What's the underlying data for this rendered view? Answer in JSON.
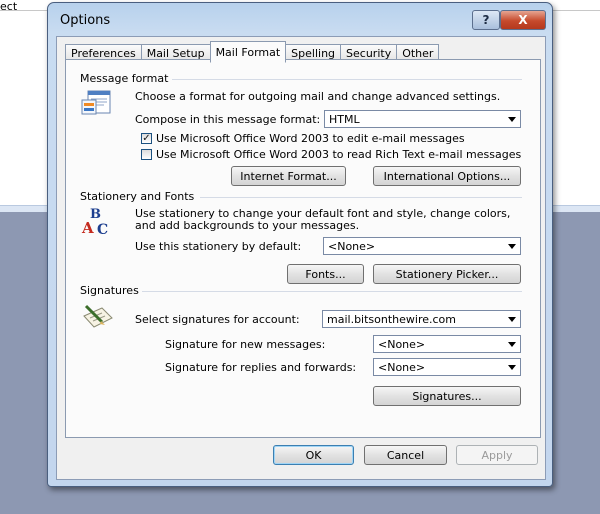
{
  "background": {
    "corner_text": "ect"
  },
  "dialog": {
    "title": "Options",
    "help_glyph": "?",
    "close_glyph": "X",
    "tabs": [
      {
        "label": "Preferences",
        "active": false
      },
      {
        "label": "Mail Setup",
        "active": false
      },
      {
        "label": "Mail Format",
        "active": true
      },
      {
        "label": "Spelling",
        "active": false
      },
      {
        "label": "Security",
        "active": false
      },
      {
        "label": "Other",
        "active": false
      }
    ],
    "message_format": {
      "label": "Message format",
      "description": "Choose a format for outgoing mail and change advanced settings.",
      "compose_label": "Compose in this message format:",
      "compose_value": "HTML",
      "word_edit": {
        "label": "Use Microsoft Office Word 2003 to edit e-mail messages",
        "checked": true,
        "glyph": "✓"
      },
      "word_read": {
        "label": "Use Microsoft Office Word 2003 to read Rich Text e-mail messages",
        "checked": false
      },
      "internet_format_button": "Internet Format...",
      "international_options_button": "International Options..."
    },
    "stationery": {
      "label": "Stationery and Fonts",
      "description_1": "Use stationery to change your default font and style, change colors,",
      "description_2": "and add backgrounds to your messages.",
      "default_label": "Use this stationery by default:",
      "default_value": "<None>",
      "fonts_button": "Fonts...",
      "picker_button": "Stationery Picker..."
    },
    "signatures": {
      "label": "Signatures",
      "account_label": "Select signatures for account:",
      "account_value": "mail.bitsonthewire.com",
      "new_label": "Signature for new messages:",
      "new_value": "<None>",
      "reply_label": "Signature for replies and forwards:",
      "reply_value": "<None>",
      "signatures_button": "Signatures..."
    },
    "footer": {
      "ok": "OK",
      "cancel": "Cancel",
      "apply": "Apply"
    }
  }
}
